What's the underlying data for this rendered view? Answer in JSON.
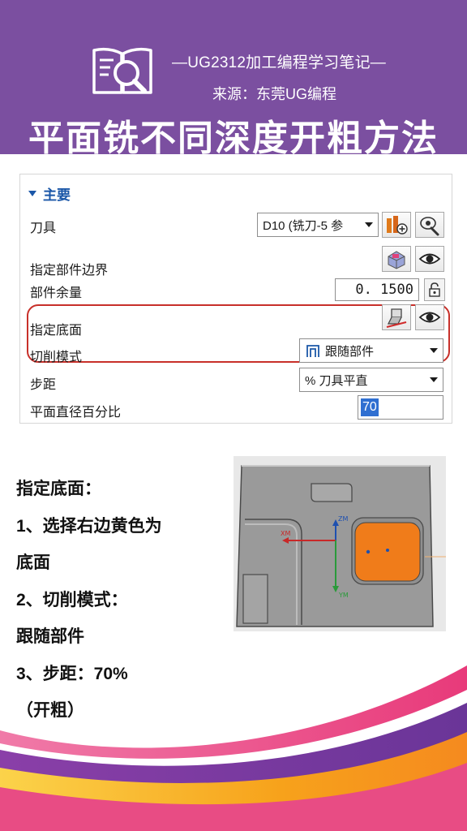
{
  "header": {
    "subtitle": "—UG2312加工编程学习笔记—",
    "source": "来源：东莞UG编程",
    "title": "平面铣不同深度开粗方法",
    "icon": "book-search-icon",
    "background_color": "#7b4fa0"
  },
  "dialog": {
    "section_title": "主要",
    "rows": [
      {
        "label": "刀具",
        "control": "dropdown",
        "value": "D10 (铣刀-5 参",
        "buttons": [
          "new-tool-icon",
          "edit-tool-icon"
        ]
      },
      {
        "label": "指定部件边界",
        "buttons": [
          "select-boundary-icon",
          "display-eye-icon"
        ]
      },
      {
        "label": "部件余量",
        "value": "0. 1500",
        "buttons": [
          "lock-icon"
        ]
      },
      {
        "label": "指定底面",
        "buttons": [
          "select-floor-icon",
          "display-eye-icon"
        ],
        "highlighted": true
      },
      {
        "label": "切削模式",
        "control": "dropdown",
        "value": "跟随部件",
        "highlighted": true
      },
      {
        "label": "步距",
        "control": "dropdown",
        "value": "% 刀具平直"
      },
      {
        "label": "平面直径百分比",
        "value": "70"
      }
    ],
    "highlight_color": "#c8302a"
  },
  "instructions": [
    "指定底面：",
    "1、选择右边黄色为",
    "底面",
    "2、切削模式：",
    "跟随部件",
    "3、步距：70%",
    "（开粗）"
  ],
  "viewport": {
    "axis_labels": {
      "x": "XM",
      "y": "YM",
      "z": "ZM"
    },
    "floor_color": "#f07c1a",
    "part_color": "#9a9a9a"
  },
  "decoration": {
    "wave_colors": [
      "#7b3fa0",
      "#e8418a",
      "#f7a21b",
      "#fbd34a"
    ]
  }
}
